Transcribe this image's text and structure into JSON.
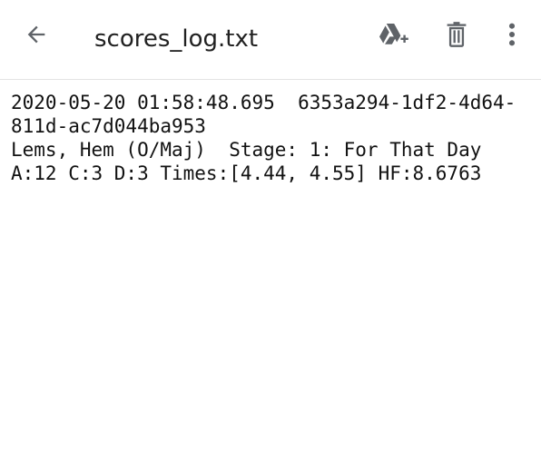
{
  "header": {
    "title": "scores_log.txt",
    "back_icon": "arrow-back-icon",
    "drive_icon": "add-to-drive-icon",
    "delete_icon": "trash-icon",
    "more_icon": "more-vert-icon"
  },
  "file": {
    "lines": [
      "2020-05-20 01:58:48.695  6353a294-1df2-4d64-",
      "811d-ac7d044ba953",
      "Lems, Hem (O/Maj)  Stage: 1: For That Day",
      "A:12 C:3 D:3 Times:[4.44, 4.55] HF:8.6763"
    ]
  },
  "colors": {
    "icon": "#5f6368",
    "text": "#111111",
    "divider": "#e3e3e3"
  }
}
